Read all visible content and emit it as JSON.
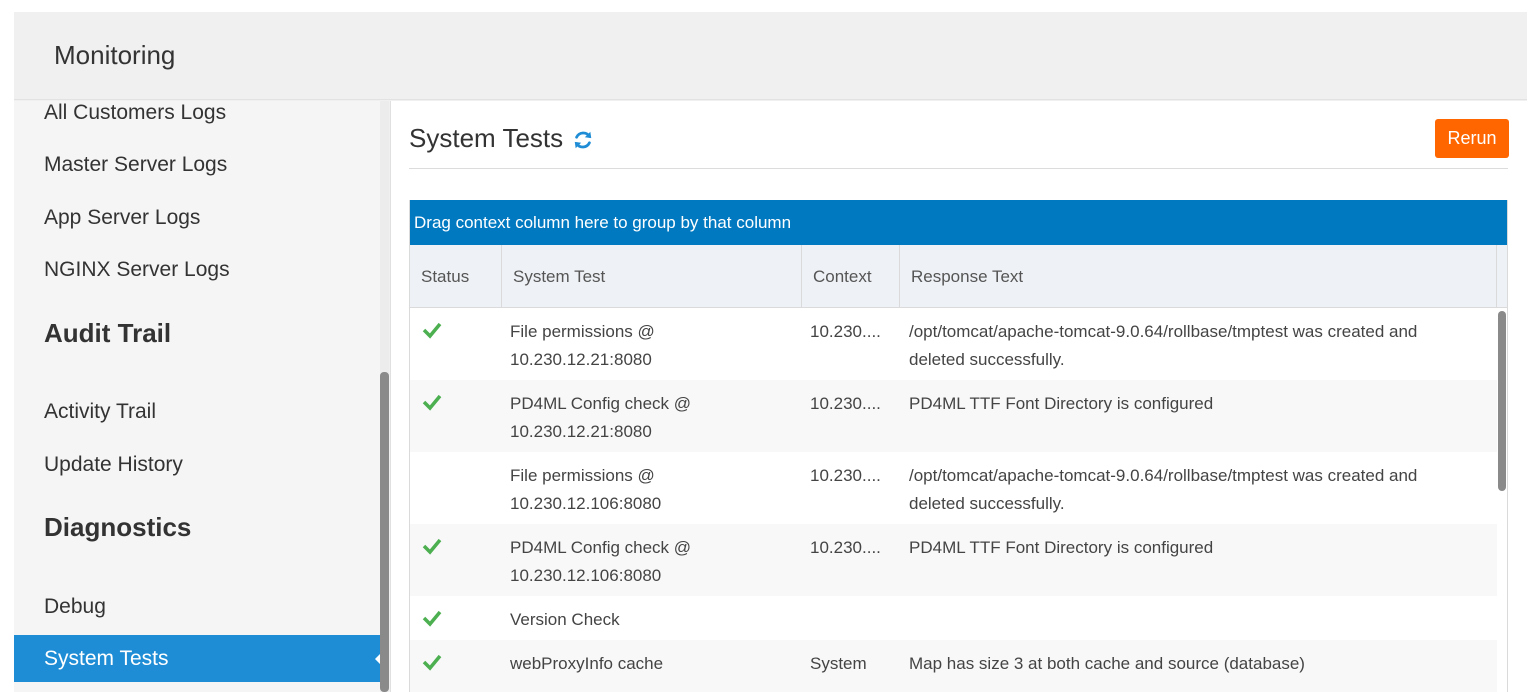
{
  "app": {
    "title": "Monitoring"
  },
  "sidebar": {
    "items": [
      {
        "label": "All Customers Logs"
      },
      {
        "label": "Master Server Logs"
      },
      {
        "label": "App Server Logs"
      },
      {
        "label": "NGINX Server Logs"
      }
    ],
    "audit_heading": "Audit Trail",
    "audit_items": [
      {
        "label": "Activity Trail"
      },
      {
        "label": "Update History"
      }
    ],
    "diagnostics_heading": "Diagnostics",
    "diagnostics_items": [
      {
        "label": "Debug"
      },
      {
        "label": "System Tests",
        "active": true
      }
    ]
  },
  "main": {
    "title": "System Tests",
    "refresh_icon": "refresh-icon",
    "rerun_label": "Rerun",
    "group_bar_text": "Drag context column here to group by that column",
    "columns": [
      "Status",
      "System Test",
      "Context",
      "Response Text"
    ],
    "rows": [
      {
        "status": "pass",
        "test": [
          "File permissions @",
          "10.230.12.21:8080"
        ],
        "context": "10.230....",
        "response": [
          "/opt/tomcat/apache-tomcat-9.0.64/rollbase/tmptest was created and",
          "deleted successfully."
        ]
      },
      {
        "status": "pass",
        "test": [
          "PD4ML Config check @",
          "10.230.12.21:8080"
        ],
        "context": "10.230....",
        "response": [
          "PD4ML TTF Font Directory is configured",
          ""
        ]
      },
      {
        "status": "",
        "test": [
          "File permissions @",
          "10.230.12.106:8080"
        ],
        "context": "10.230....",
        "response": [
          "/opt/tomcat/apache-tomcat-9.0.64/rollbase/tmptest was created and",
          "deleted successfully."
        ]
      },
      {
        "status": "pass",
        "test": [
          "PD4ML Config check @",
          "10.230.12.106:8080"
        ],
        "context": "10.230....",
        "response": [
          "PD4ML TTF Font Directory is configured",
          ""
        ]
      },
      {
        "status": "pass",
        "test": [
          "Version Check",
          ""
        ],
        "context": "",
        "response": [
          "",
          ""
        ]
      },
      {
        "status": "pass",
        "test": [
          "webProxyInfo cache",
          ""
        ],
        "context": "System",
        "response": [
          "Map has size 3 at both cache and source (database)",
          ""
        ]
      }
    ]
  },
  "colors": {
    "accent": "#1f8dd6",
    "group_bar": "#0079c1",
    "rerun": "#ff6600",
    "check": "#4caf50"
  }
}
